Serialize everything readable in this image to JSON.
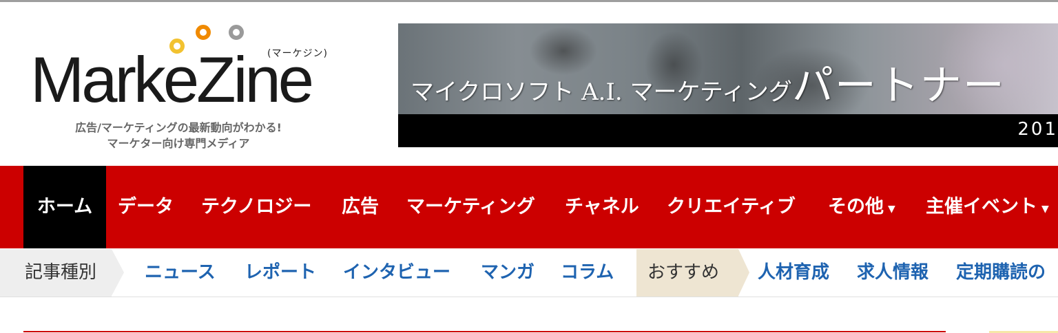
{
  "logo": {
    "wordmark": "MarkeZine",
    "reading": "(マーケジン)",
    "tagline_line1": "広告/マーケティングの最新動向がわかる!",
    "tagline_line2": "マーケター向け専門メディア",
    "dot_colors": [
      "#f2c230",
      "#f08a00",
      "#9a9a9a"
    ]
  },
  "banner": {
    "headline_small": "マイクロソフト A.I. マーケティング",
    "headline_large": "パートナー",
    "year": "201"
  },
  "main_nav": {
    "items": [
      {
        "label": "ホーム",
        "active": true
      },
      {
        "label": "データ"
      },
      {
        "label": "テクノロジー"
      },
      {
        "label": "広告"
      },
      {
        "label": "マーケティング"
      },
      {
        "label": "チャネル"
      },
      {
        "label": "クリエイティブ"
      },
      {
        "label": "その他",
        "caret": "▼"
      },
      {
        "label": "主催イベント",
        "caret": "▼"
      }
    ],
    "background": "#cc0000",
    "active_background": "#000000"
  },
  "sub_nav": {
    "category_label": "記事種別",
    "category_links": [
      "ニュース",
      "レポート",
      "インタビュー",
      "マンガ",
      "コラム"
    ],
    "recommend_label": "おすすめ",
    "recommend_links": [
      "人材育成",
      "求人情報",
      "定期購読の"
    ],
    "link_color": "#1e63b0"
  }
}
